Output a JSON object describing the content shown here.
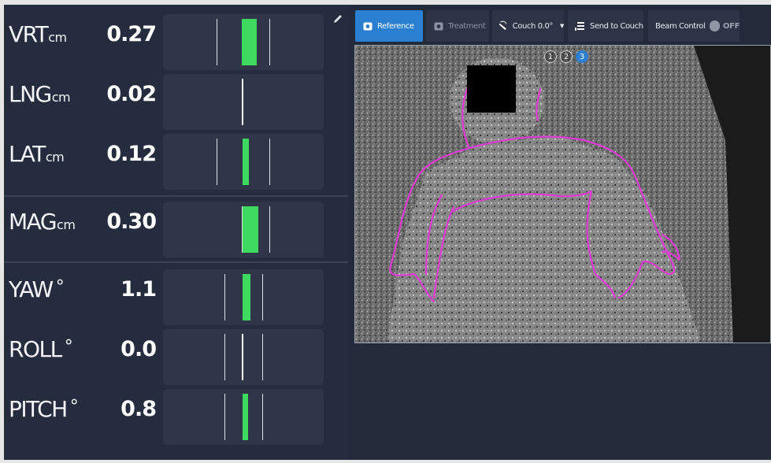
{
  "metrics": [
    {
      "name": "VRT",
      "unit": "cm",
      "value": "0.27"
    },
    {
      "name": "LNG",
      "unit": "cm",
      "value": "0.02"
    },
    {
      "name": "LAT",
      "unit": "cm",
      "value": "0.12"
    },
    {
      "name": "MAG",
      "unit": "cm",
      "value": "0.30"
    },
    {
      "name": "YAW",
      "unit": "°",
      "value": "1.1"
    },
    {
      "name": "ROLL",
      "unit": "°",
      "value": "0.0"
    },
    {
      "name": "PITCH",
      "unit": "°",
      "value": "0.8"
    }
  ],
  "toolbar": {
    "reference_label": "Reference",
    "treatment_label": "Treatment",
    "couch_label": "Couch 0.0°",
    "send_label": "Send to Couch",
    "beam_label": "Beam Control",
    "beam_state": "OFF"
  },
  "camera": {
    "steps": [
      "1",
      "2",
      "3"
    ],
    "active_step": "3"
  },
  "colors": {
    "accent": "#2b7fd1",
    "bar": "#3ed95f",
    "outline": "#e03ad6",
    "panel": "#252c3d"
  }
}
